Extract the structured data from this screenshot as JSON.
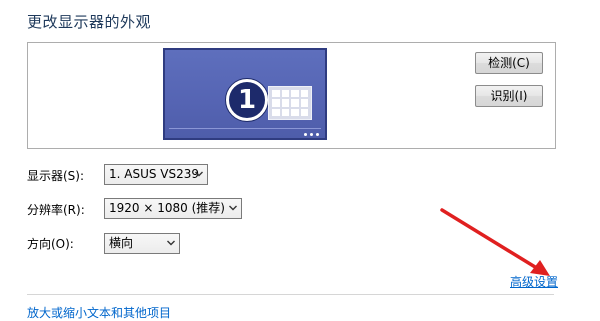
{
  "page": {
    "title": "更改显示器的外观"
  },
  "preview": {
    "monitor_number": "1",
    "detect_label": "检测(C)",
    "identify_label": "识别(I)",
    "screen_color": "#5564b3"
  },
  "form": {
    "display_label": "显示器(S):",
    "display_value": "1. ASUS VS239",
    "resolution_label": "分辨率(R):",
    "resolution_value": "1920 × 1080 (推荐)",
    "orientation_label": "方向(O):",
    "orientation_value": "横向"
  },
  "links": {
    "advanced_settings": "高级设置",
    "next_section_partial": "放大或缩小文本和其他项目"
  },
  "annotations": {
    "arrow_color": "#e02020"
  },
  "icons": {
    "dropdown": "chevron-down-icon",
    "arrow": "red-arrow-annotation"
  }
}
